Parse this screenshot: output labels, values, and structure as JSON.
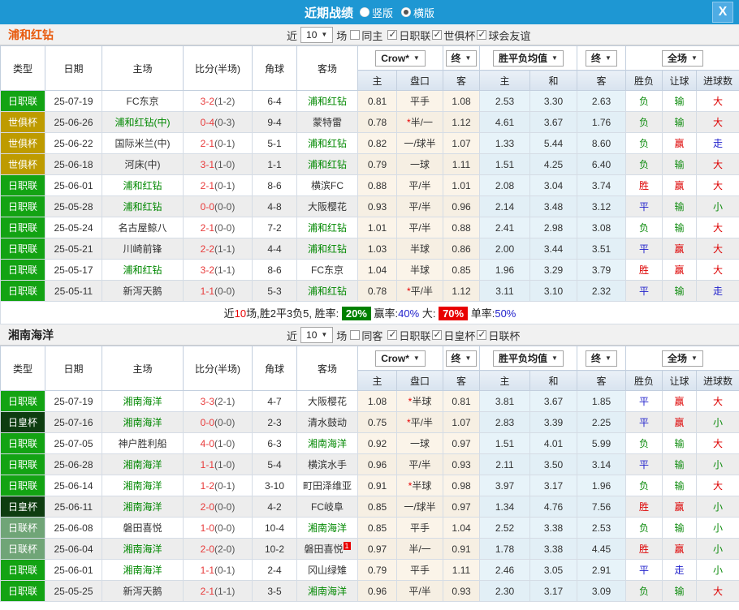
{
  "titlebar": {
    "title": "近期战绩",
    "close": "X",
    "radios": [
      {
        "label": "竖版",
        "selected": false
      },
      {
        "label": "横版",
        "selected": true
      }
    ]
  },
  "table_header": {
    "cols": [
      "类型",
      "日期",
      "主场",
      "比分(半场)",
      "角球",
      "客场"
    ],
    "sub": [
      "主",
      "盘口",
      "客",
      "主",
      "和",
      "客",
      "胜负",
      "让球",
      "进球数"
    ],
    "odds_source": "Crow*",
    "odds_period": "终",
    "mean_source": "胜平负均值",
    "mean_period": "终",
    "scope": "全场"
  },
  "colors": {
    "titlebar_bg": "#1E97D3",
    "focus_team": "#008800",
    "win": "#DD0000",
    "draw": "#2222CC",
    "lose": "#0F8C0F",
    "type_colors": {
      "日职联": "#13A313",
      "世俱杯": "#BE9B00",
      "日皇杯": "#0E3D10",
      "日联杯": "#70A577"
    }
  },
  "sections": [
    {
      "team": "浦和红钻",
      "team_color": "#E8590C",
      "filter": {
        "near": "近",
        "count": "10",
        "field": "场",
        "same": {
          "label": "同主",
          "checked": false
        },
        "leagues": [
          {
            "label": "日职联",
            "checked": true
          },
          {
            "label": "世俱杯",
            "checked": true
          },
          {
            "label": "球会友谊",
            "checked": true
          }
        ]
      },
      "rows": [
        {
          "type": "日职联",
          "date": "25-07-19",
          "home": "FC东京",
          "home_focus": false,
          "score": "3-2",
          "half": "(1-2)",
          "corners": "6-4",
          "away": "浦和红钻",
          "away_focus": true,
          "away_sup": "",
          "odds": [
            "0.81",
            "平手",
            "1.08"
          ],
          "mean": [
            "2.53",
            "3.30",
            "2.63"
          ],
          "results": [
            "负",
            "输",
            "大"
          ]
        },
        {
          "type": "世俱杯",
          "date": "25-06-26",
          "home": "浦和红钻(中)",
          "home_focus": true,
          "score": "0-4",
          "half": "(0-3)",
          "corners": "9-4",
          "away": "蒙特雷",
          "away_focus": false,
          "away_sup": "",
          "odds": [
            "0.78",
            "*半/一",
            "1.12"
          ],
          "mean": [
            "4.61",
            "3.67",
            "1.76"
          ],
          "results": [
            "负",
            "输",
            "大"
          ]
        },
        {
          "type": "世俱杯",
          "date": "25-06-22",
          "home": "国际米兰(中)",
          "home_focus": false,
          "score": "2-1",
          "half": "(0-1)",
          "corners": "5-1",
          "away": "浦和红钻",
          "away_focus": true,
          "away_sup": "",
          "odds": [
            "0.82",
            "一/球半",
            "1.07"
          ],
          "mean": [
            "1.33",
            "5.44",
            "8.60"
          ],
          "results": [
            "负",
            "赢",
            "走"
          ]
        },
        {
          "type": "世俱杯",
          "date": "25-06-18",
          "home": "河床(中)",
          "home_focus": false,
          "score": "3-1",
          "half": "(1-0)",
          "corners": "1-1",
          "away": "浦和红钻",
          "away_focus": true,
          "away_sup": "",
          "odds": [
            "0.79",
            "一球",
            "1.11"
          ],
          "mean": [
            "1.51",
            "4.25",
            "6.40"
          ],
          "results": [
            "负",
            "输",
            "大"
          ]
        },
        {
          "type": "日职联",
          "date": "25-06-01",
          "home": "浦和红钻",
          "home_focus": true,
          "score": "2-1",
          "half": "(0-1)",
          "corners": "8-6",
          "away": "横滨FC",
          "away_focus": false,
          "away_sup": "",
          "odds": [
            "0.88",
            "平/半",
            "1.01"
          ],
          "mean": [
            "2.08",
            "3.04",
            "3.74"
          ],
          "results": [
            "胜",
            "赢",
            "大"
          ]
        },
        {
          "type": "日职联",
          "date": "25-05-28",
          "home": "浦和红钻",
          "home_focus": true,
          "score": "0-0",
          "half": "(0-0)",
          "corners": "4-8",
          "away": "大阪樱花",
          "away_focus": false,
          "away_sup": "",
          "odds": [
            "0.93",
            "平/半",
            "0.96"
          ],
          "mean": [
            "2.14",
            "3.48",
            "3.12"
          ],
          "results": [
            "平",
            "输",
            "小"
          ]
        },
        {
          "type": "日职联",
          "date": "25-05-24",
          "home": "名古屋鲸八",
          "home_focus": false,
          "score": "2-1",
          "half": "(0-0)",
          "corners": "7-2",
          "away": "浦和红钻",
          "away_focus": true,
          "away_sup": "",
          "odds": [
            "1.01",
            "平/半",
            "0.88"
          ],
          "mean": [
            "2.41",
            "2.98",
            "3.08"
          ],
          "results": [
            "负",
            "输",
            "大"
          ]
        },
        {
          "type": "日职联",
          "date": "25-05-21",
          "home": "川崎前锋",
          "home_focus": false,
          "score": "2-2",
          "half": "(1-1)",
          "corners": "4-4",
          "away": "浦和红钻",
          "away_focus": true,
          "away_sup": "",
          "odds": [
            "1.03",
            "半球",
            "0.86"
          ],
          "mean": [
            "2.00",
            "3.44",
            "3.51"
          ],
          "results": [
            "平",
            "赢",
            "大"
          ]
        },
        {
          "type": "日职联",
          "date": "25-05-17",
          "home": "浦和红钻",
          "home_focus": true,
          "score": "3-2",
          "half": "(1-1)",
          "corners": "8-6",
          "away": "FC东京",
          "away_focus": false,
          "away_sup": "",
          "odds": [
            "1.04",
            "半球",
            "0.85"
          ],
          "mean": [
            "1.96",
            "3.29",
            "3.79"
          ],
          "results": [
            "胜",
            "赢",
            "大"
          ]
        },
        {
          "type": "日职联",
          "date": "25-05-11",
          "home": "新泻天鹅",
          "home_focus": false,
          "score": "1-1",
          "half": "(0-0)",
          "corners": "5-3",
          "away": "浦和红钻",
          "away_focus": true,
          "away_sup": "",
          "odds": [
            "0.78",
            "*平/半",
            "1.12"
          ],
          "mean": [
            "3.11",
            "3.10",
            "2.32"
          ],
          "results": [
            "平",
            "输",
            "走"
          ]
        }
      ],
      "summary": {
        "prefix": "近",
        "count": "10",
        "text1": "场,胜2平3负5, 胜率:",
        "win_pct": "20%",
        "label_win": "赢率:",
        "win2_pct": "40%",
        "label_big": "大:",
        "big_pct": "70%",
        "label_single": "单率:",
        "single_pct": "50%"
      }
    },
    {
      "team": "湘南海洋",
      "team_color": "#222222",
      "filter": {
        "near": "近",
        "count": "10",
        "field": "场",
        "same": {
          "label": "同客",
          "checked": false
        },
        "leagues": [
          {
            "label": "日职联",
            "checked": true
          },
          {
            "label": "日皇杯",
            "checked": true
          },
          {
            "label": "日联杯",
            "checked": true
          }
        ]
      },
      "rows": [
        {
          "type": "日职联",
          "date": "25-07-19",
          "home": "湘南海洋",
          "home_focus": true,
          "score": "3-3",
          "half": "(2-1)",
          "corners": "4-7",
          "away": "大阪樱花",
          "away_focus": false,
          "away_sup": "",
          "odds": [
            "1.08",
            "*半球",
            "0.81"
          ],
          "mean": [
            "3.81",
            "3.67",
            "1.85"
          ],
          "results": [
            "平",
            "赢",
            "大"
          ]
        },
        {
          "type": "日皇杯",
          "date": "25-07-16",
          "home": "湘南海洋",
          "home_focus": true,
          "score": "0-0",
          "half": "(0-0)",
          "corners": "2-3",
          "away": "清水鼓动",
          "away_focus": false,
          "away_sup": "",
          "odds": [
            "0.75",
            "*平/半",
            "1.07"
          ],
          "mean": [
            "2.83",
            "3.39",
            "2.25"
          ],
          "results": [
            "平",
            "赢",
            "小"
          ]
        },
        {
          "type": "日职联",
          "date": "25-07-05",
          "home": "神户胜利船",
          "home_focus": false,
          "score": "4-0",
          "half": "(1-0)",
          "corners": "6-3",
          "away": "湘南海洋",
          "away_focus": true,
          "away_sup": "",
          "odds": [
            "0.92",
            "一球",
            "0.97"
          ],
          "mean": [
            "1.51",
            "4.01",
            "5.99"
          ],
          "results": [
            "负",
            "输",
            "大"
          ]
        },
        {
          "type": "日职联",
          "date": "25-06-28",
          "home": "湘南海洋",
          "home_focus": true,
          "score": "1-1",
          "half": "(1-0)",
          "corners": "5-4",
          "away": "横滨水手",
          "away_focus": false,
          "away_sup": "",
          "odds": [
            "0.96",
            "平/半",
            "0.93"
          ],
          "mean": [
            "2.11",
            "3.50",
            "3.14"
          ],
          "results": [
            "平",
            "输",
            "小"
          ]
        },
        {
          "type": "日职联",
          "date": "25-06-14",
          "home": "湘南海洋",
          "home_focus": true,
          "score": "1-2",
          "half": "(0-1)",
          "corners": "3-10",
          "away": "町田泽维亚",
          "away_focus": false,
          "away_sup": "",
          "odds": [
            "0.91",
            "*半球",
            "0.98"
          ],
          "mean": [
            "3.97",
            "3.17",
            "1.96"
          ],
          "results": [
            "负",
            "输",
            "大"
          ]
        },
        {
          "type": "日皇杯",
          "date": "25-06-11",
          "home": "湘南海洋",
          "home_focus": true,
          "score": "2-0",
          "half": "(0-0)",
          "corners": "4-2",
          "away": "FC岐阜",
          "away_focus": false,
          "away_sup": "",
          "odds": [
            "0.85",
            "一/球半",
            "0.97"
          ],
          "mean": [
            "1.34",
            "4.76",
            "7.56"
          ],
          "results": [
            "胜",
            "赢",
            "小"
          ]
        },
        {
          "type": "日联杯",
          "date": "25-06-08",
          "home": "磐田喜悦",
          "home_focus": false,
          "score": "1-0",
          "half": "(0-0)",
          "corners": "10-4",
          "away": "湘南海洋",
          "away_focus": true,
          "away_sup": "",
          "odds": [
            "0.85",
            "平手",
            "1.04"
          ],
          "mean": [
            "2.52",
            "3.38",
            "2.53"
          ],
          "results": [
            "负",
            "输",
            "小"
          ]
        },
        {
          "type": "日联杯",
          "date": "25-06-04",
          "home": "湘南海洋",
          "home_focus": true,
          "score": "2-0",
          "half": "(2-0)",
          "corners": "10-2",
          "away": "磐田喜悦",
          "away_focus": false,
          "away_sup": "1",
          "odds": [
            "0.97",
            "半/一",
            "0.91"
          ],
          "mean": [
            "1.78",
            "3.38",
            "4.45"
          ],
          "results": [
            "胜",
            "赢",
            "小"
          ]
        },
        {
          "type": "日职联",
          "date": "25-06-01",
          "home": "湘南海洋",
          "home_focus": true,
          "score": "1-1",
          "half": "(0-1)",
          "corners": "2-4",
          "away": "冈山绿雉",
          "away_focus": false,
          "away_sup": "",
          "odds": [
            "0.79",
            "平手",
            "1.11"
          ],
          "mean": [
            "2.46",
            "3.05",
            "2.91"
          ],
          "results": [
            "平",
            "走",
            "小"
          ]
        },
        {
          "type": "日职联",
          "date": "25-05-25",
          "home": "新泻天鹅",
          "home_focus": false,
          "score": "2-1",
          "half": "(1-1)",
          "corners": "3-5",
          "away": "湘南海洋",
          "away_focus": true,
          "away_sup": "",
          "odds": [
            "0.96",
            "平/半",
            "0.93"
          ],
          "mean": [
            "2.30",
            "3.17",
            "3.09"
          ],
          "results": [
            "负",
            "输",
            "大"
          ]
        }
      ],
      "summary": null
    }
  ]
}
